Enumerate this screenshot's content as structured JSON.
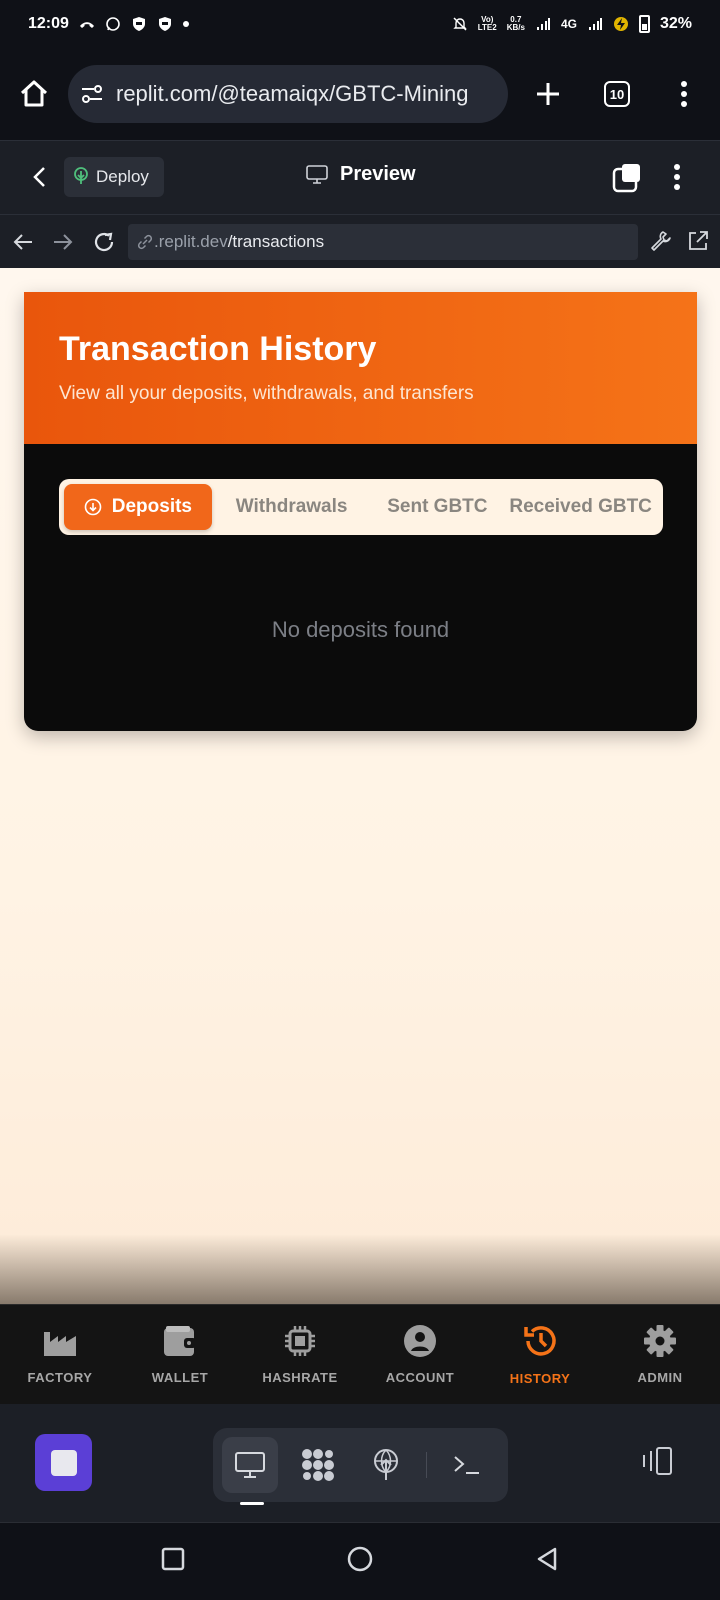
{
  "status_bar": {
    "time": "12:09",
    "network_speed_value": "0.7",
    "network_speed_unit": "KB/s",
    "volte_line1": "Vo)",
    "volte_line2": "LTE2",
    "network_type": "4G",
    "battery": "32%"
  },
  "browser": {
    "url": "replit.com/@teamaiqx/GBTC-Mining",
    "tab_count": "10"
  },
  "replit_header": {
    "deploy_label": "Deploy",
    "preview_label": "Preview"
  },
  "address_bar": {
    "domain": ".replit.dev",
    "path": "/transactions"
  },
  "page": {
    "title": "Transaction History",
    "subtitle": "View all your deposits, withdrawals, and transfers",
    "tabs": [
      {
        "label": "Deposits",
        "active": true
      },
      {
        "label": "Withdrawals",
        "active": false
      },
      {
        "label": "Sent GBTC",
        "active": false
      },
      {
        "label": "Received GBTC",
        "active": false
      }
    ],
    "empty_message": "No deposits found"
  },
  "app_nav": {
    "items": [
      {
        "label": "FACTORY",
        "icon": "factory-icon"
      },
      {
        "label": "WALLET",
        "icon": "wallet-icon"
      },
      {
        "label": "HASHRATE",
        "icon": "chip-icon"
      },
      {
        "label": "ACCOUNT",
        "icon": "account-icon"
      },
      {
        "label": "HISTORY",
        "icon": "history-icon",
        "active": true
      },
      {
        "label": "ADMIN",
        "icon": "gear-icon"
      }
    ]
  },
  "colors": {
    "accent": "#f57318",
    "header_gradient_start": "#e9560c",
    "stop_button": "#5b3fd6"
  }
}
